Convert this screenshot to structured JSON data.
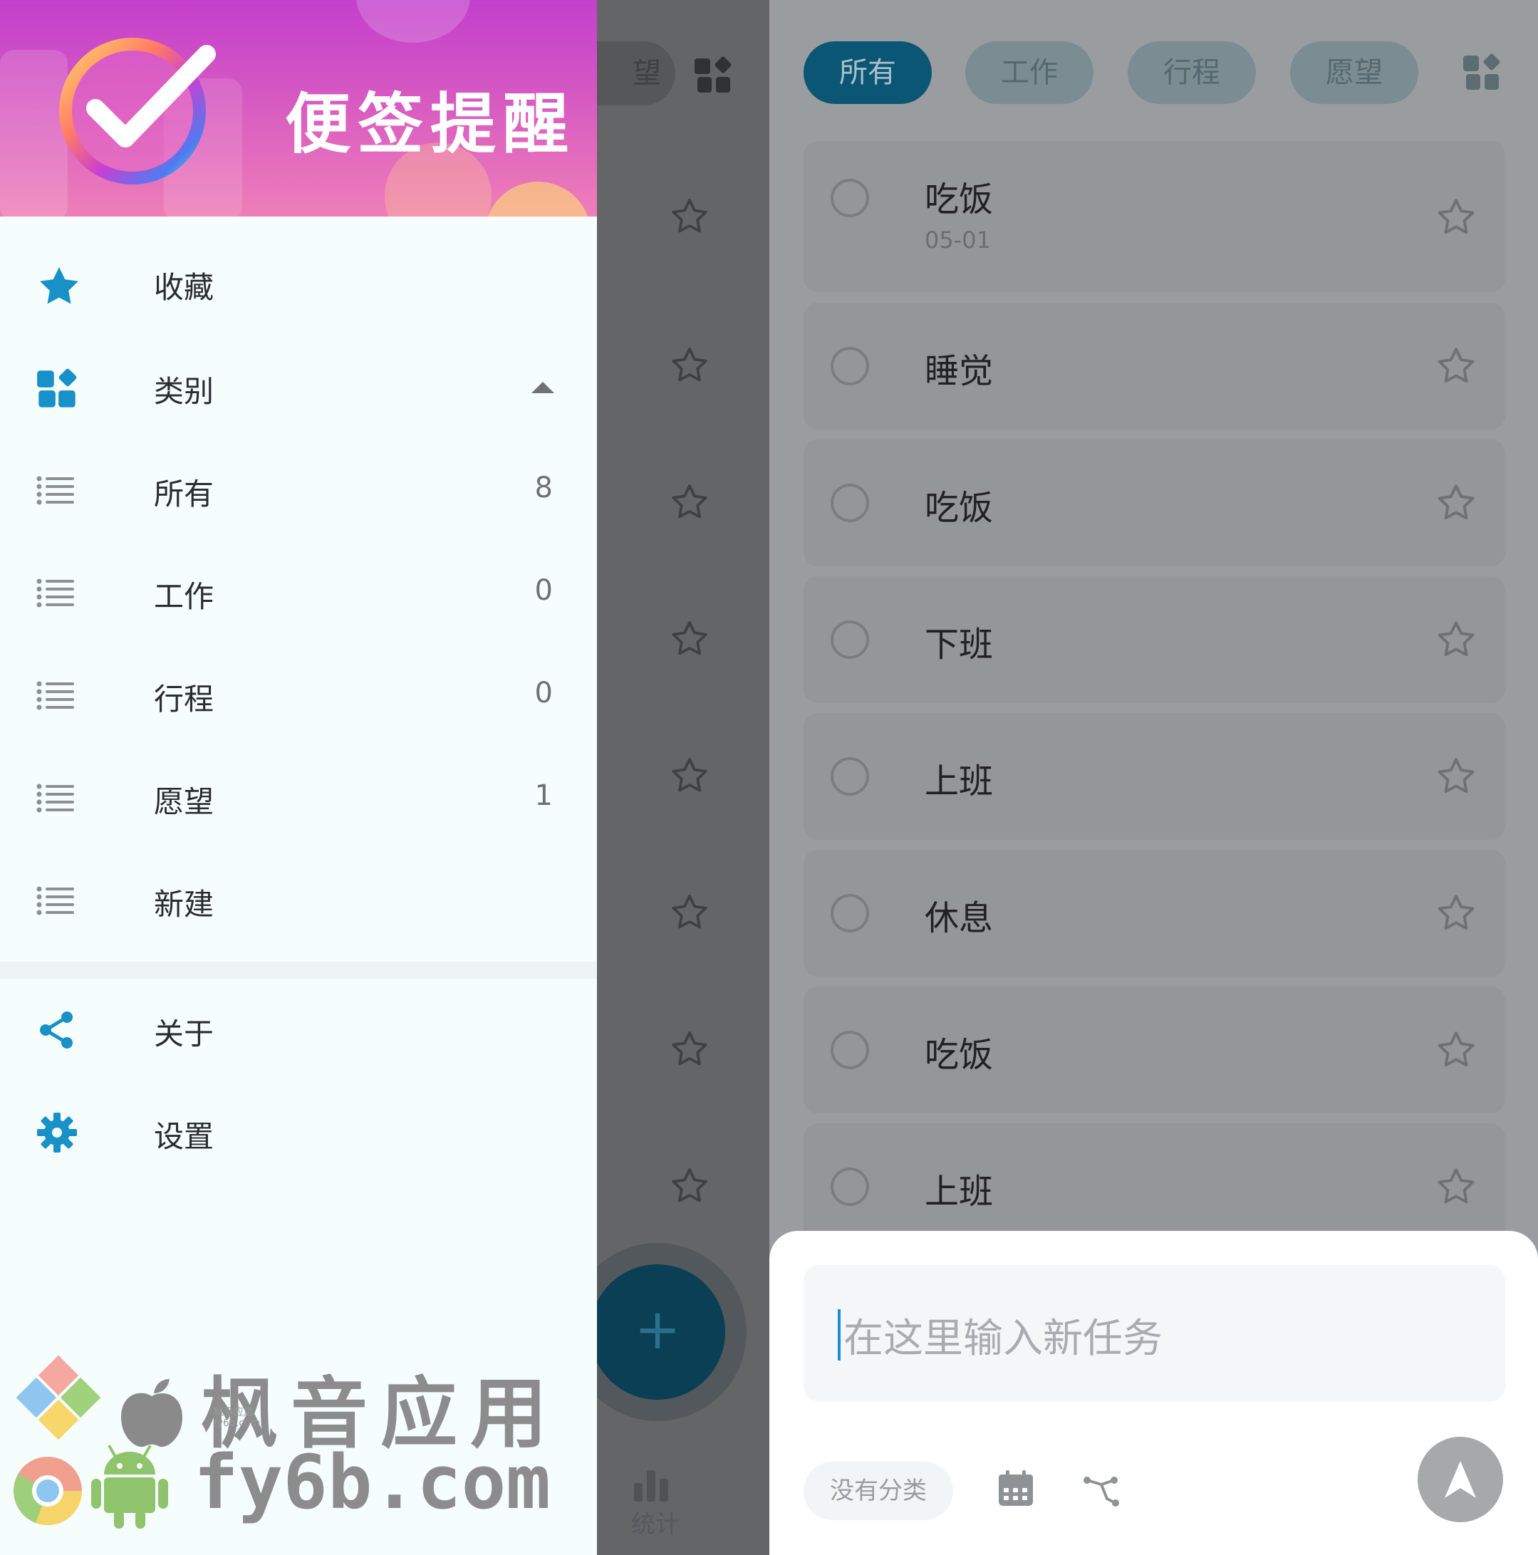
{
  "drawer": {
    "app_name": "便签提醒",
    "items": [
      {
        "label": "收藏",
        "icon": "star-icon"
      },
      {
        "label": "类别",
        "icon": "category-icon"
      },
      {
        "label": "所有",
        "count": "8",
        "icon": "list-icon"
      },
      {
        "label": "工作",
        "count": "0",
        "icon": "list-icon"
      },
      {
        "label": "行程",
        "count": "0",
        "icon": "list-icon"
      },
      {
        "label": "愿望",
        "count": "1",
        "icon": "list-icon"
      },
      {
        "label": "新建",
        "icon": "list-icon"
      }
    ],
    "footer_items": [
      {
        "label": "关于",
        "icon": "share-icon"
      },
      {
        "label": "设置",
        "icon": "gear-icon"
      }
    ]
  },
  "middle": {
    "chip_partial": "望",
    "fab_label": "+",
    "stats_label": "统计"
  },
  "tabs": [
    {
      "label": "所有",
      "active": true
    },
    {
      "label": "工作",
      "active": false
    },
    {
      "label": "行程",
      "active": false
    },
    {
      "label": "愿望",
      "active": false
    }
  ],
  "tasks": [
    {
      "title": "吃饭",
      "date": "05-01"
    },
    {
      "title": "睡觉"
    },
    {
      "title": "吃饭"
    },
    {
      "title": "下班"
    },
    {
      "title": "上班"
    },
    {
      "title": "休息"
    },
    {
      "title": "吃饭"
    },
    {
      "title": "上班"
    }
  ],
  "new_task": {
    "placeholder": "在这里输入新任务",
    "category": "没有分类"
  },
  "watermark": {
    "name": "枫音应用",
    "url": "fy6b.com",
    "small_name": "枫音应用",
    "small_url": "fy6b.com"
  },
  "colors": {
    "accent": "#1a8fd0",
    "active_tab": "#0c5675",
    "header_gradient_top": "#c33fcd",
    "header_gradient_bottom": "#ee7fb8"
  }
}
